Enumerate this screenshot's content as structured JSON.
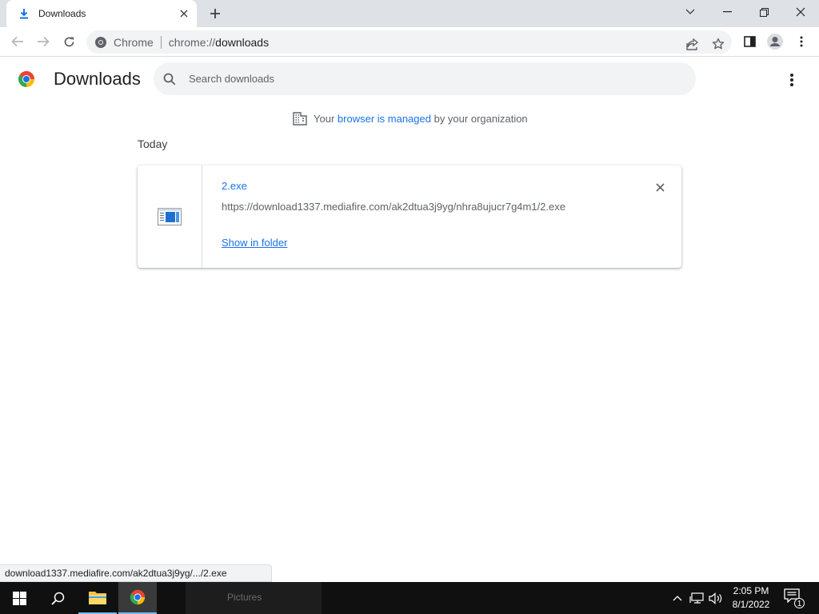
{
  "tab": {
    "title": "Downloads",
    "icon": "download-icon"
  },
  "omnibox": {
    "site_chip": "Chrome",
    "url_scheme": "chrome://",
    "url_host": "downloads"
  },
  "page": {
    "title": "Downloads",
    "search_placeholder": "Search downloads"
  },
  "managed": {
    "prefix": "Your",
    "link": "browser is managed",
    "suffix": "by your organization"
  },
  "section": {
    "label": "Today"
  },
  "download": {
    "file_name": "2.exe",
    "url": "https://download1337.mediafire.com/ak2dtua3j9yg/nhra8ujucr7g4m1/2.exe",
    "action": "Show in folder"
  },
  "status_bubble": "download1337.mediafire.com/ak2dtua3j9yg/.../2.exe",
  "taskbar": {
    "ghost_label": "Pictures",
    "time": "2:05 PM",
    "date": "8/1/2022",
    "notification_count": "1"
  },
  "colors": {
    "accent": "#1a73e8",
    "tabstrip": "#dee1e6",
    "taskbar": "#101010"
  }
}
